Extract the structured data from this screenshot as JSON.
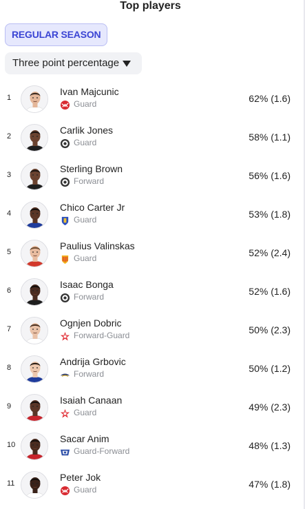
{
  "header": {
    "title": "Top players"
  },
  "filters": {
    "season_chip": "REGULAR SEASON",
    "stat_select": "Three point percentage"
  },
  "players": [
    {
      "rank": "1",
      "name": "Ivan Majcunic",
      "position": "Guard",
      "stat": "62% (1.6)",
      "team_logo": "red-ball-logo",
      "skin": "#e4b79a",
      "hair": "#3a2a20",
      "jersey": "#ffffff"
    },
    {
      "rank": "2",
      "name": "Carlik Jones",
      "position": "Guard",
      "stat": "58% (1.1)",
      "team_logo": "partizan-logo",
      "skin": "#6b4330",
      "hair": "#1c1410",
      "jersey": "#1e1e1e"
    },
    {
      "rank": "3",
      "name": "Sterling Brown",
      "position": "Forward",
      "stat": "56% (1.6)",
      "team_logo": "partizan-logo",
      "skin": "#6b4330",
      "hair": "#1c1410",
      "jersey": "#1e1e1e"
    },
    {
      "rank": "4",
      "name": "Chico Carter Jr",
      "position": "Guard",
      "stat": "53% (1.8)",
      "team_logo": "shield-logo",
      "skin": "#5a3526",
      "hair": "#140e0b",
      "jersey": "#1f3c9c"
    },
    {
      "rank": "5",
      "name": "Paulius Valinskas",
      "position": "Guard",
      "stat": "52% (2.4)",
      "team_logo": "sun-shield-logo",
      "skin": "#e8bca0",
      "hair": "#6b4a30",
      "jersey": "#d2382b"
    },
    {
      "rank": "6",
      "name": "Isaac Bonga",
      "position": "Forward",
      "stat": "52% (1.6)",
      "team_logo": "partizan-logo",
      "skin": "#4a2c20",
      "hair": "#140e0b",
      "jersey": "#1e1e1e"
    },
    {
      "rank": "7",
      "name": "Ognjen Dobric",
      "position": "Forward-Guard",
      "stat": "50% (2.3)",
      "team_logo": "star-logo",
      "skin": "#e9c2a8",
      "hair": "#4a3020",
      "jersey": "#ffffff"
    },
    {
      "rank": "8",
      "name": "Andrija Grbovic",
      "position": "Forward",
      "stat": "50% (1.2)",
      "team_logo": "wing-logo",
      "skin": "#edc8ae",
      "hair": "#2a1e16",
      "jersey": "#1f3c9c"
    },
    {
      "rank": "9",
      "name": "Isaiah Canaan",
      "position": "Guard",
      "stat": "49% (2.3)",
      "team_logo": "star-logo",
      "skin": "#5a3526",
      "hair": "#140e0b",
      "jersey": "#c8242c"
    },
    {
      "rank": "10",
      "name": "Sacar Anim",
      "position": "Guard-Forward",
      "stat": "48% (1.3)",
      "team_logo": "crest-logo",
      "skin": "#4a2c20",
      "hair": "#140e0b",
      "jersey": "#c8242c"
    },
    {
      "rank": "11",
      "name": "Peter Jok",
      "position": "Guard",
      "stat": "47% (1.8)",
      "team_logo": "red-ball-logo",
      "skin": "#3a2219",
      "hair": "#140e0b",
      "jersey": "#ffffff"
    }
  ],
  "colors": {
    "accent": "#3a44d4",
    "chip_bg": "#e6e8fd",
    "muted_text": "#8a8d93"
  }
}
